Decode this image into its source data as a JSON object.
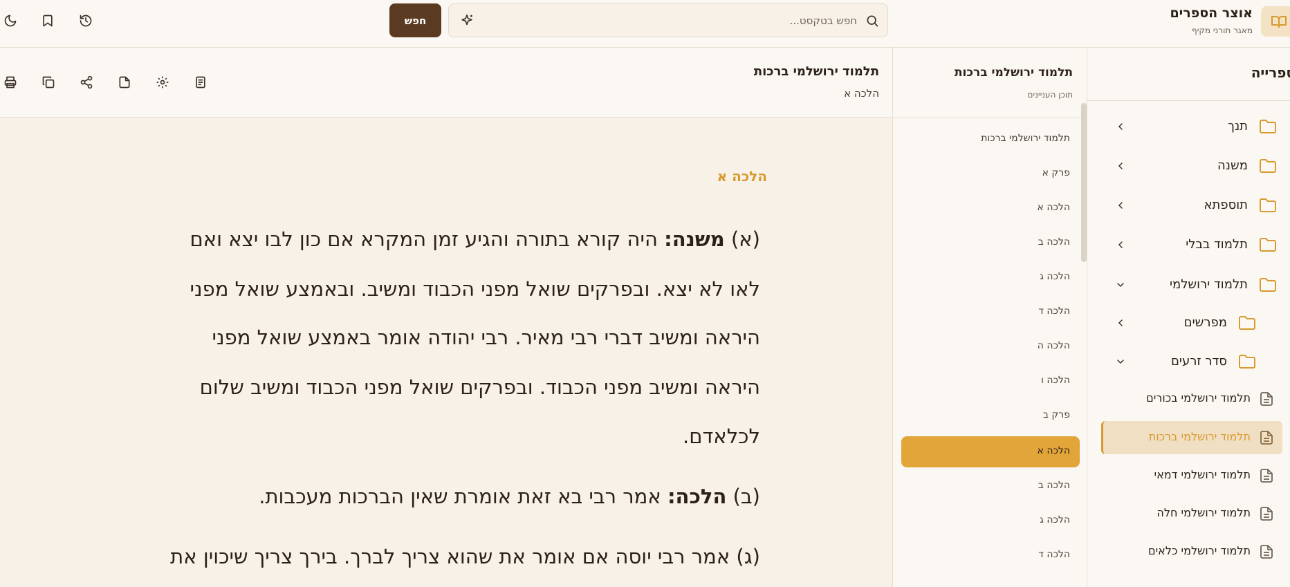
{
  "topbar": {
    "brand_title": "אוצר הספרים",
    "brand_subtitle": "מאגר תורני מקיף",
    "search_placeholder": "חפש בטקסט...",
    "search_button": "חפש"
  },
  "library": {
    "title": "ספרייה",
    "categories": [
      {
        "label": "תנך",
        "expanded": false
      },
      {
        "label": "משנה",
        "expanded": false
      },
      {
        "label": "תוספתא",
        "expanded": false
      },
      {
        "label": "תלמוד בבלי",
        "expanded": false
      },
      {
        "label": "תלמוד ירושלמי",
        "expanded": true
      }
    ],
    "subcategories": [
      {
        "label": "מפרשים",
        "expanded": false
      },
      {
        "label": "סדר זרעים",
        "expanded": true
      }
    ],
    "books": [
      {
        "label": "תלמוד ירושלמי בכורים",
        "selected": false
      },
      {
        "label": "תלמוד ירושלמי ברכות",
        "selected": true
      },
      {
        "label": "תלמוד ירושלמי דמאי",
        "selected": false
      },
      {
        "label": "תלמוד ירושלמי חלה",
        "selected": false
      },
      {
        "label": "תלמוד ירושלמי כלאים",
        "selected": false
      }
    ]
  },
  "toc": {
    "title": "תלמוד ירושלמי ברכות",
    "subtitle": "תוכן העניינים",
    "items": [
      {
        "label": "תלמוד ירושלמי ברכות",
        "active": false
      },
      {
        "label": "פרק א",
        "active": false
      },
      {
        "label": "הלכה א",
        "active": false
      },
      {
        "label": "הלכה ב",
        "active": false
      },
      {
        "label": "הלכה ג",
        "active": false
      },
      {
        "label": "הלכה ד",
        "active": false
      },
      {
        "label": "הלכה ה",
        "active": false
      },
      {
        "label": "הלכה ו",
        "active": false
      },
      {
        "label": "פרק ב",
        "active": false
      },
      {
        "label": "הלכה א",
        "active": true
      },
      {
        "label": "הלכה ב",
        "active": false
      },
      {
        "label": "הלכה ג",
        "active": false
      },
      {
        "label": "הלכה ד",
        "active": false
      }
    ]
  },
  "content": {
    "title": "תלמוד ירושלמי ברכות",
    "subtitle": "הלכה א",
    "section_heading": "הלכה א",
    "lines": [
      {
        "prefix": "(א) ",
        "bold": "משנה:",
        "text": " היה קורא בתורה והגיע זמן המקרא אם כון לבו יצא ואם"
      },
      {
        "prefix": "",
        "bold": "",
        "text": "לאו לא יצא. ובפרקים שואל מפני הכבוד ומשיב. ובאמצע שואל מפני"
      },
      {
        "prefix": "",
        "bold": "",
        "text": "היראה ומשיב דברי רבי מאיר. רבי יהודה אומר באמצע שואל מפני"
      },
      {
        "prefix": "",
        "bold": "",
        "text": "היראה ומשיב מפני הכבוד. ובפרקים שואל מפני הכבוד ומשיב שלום"
      },
      {
        "prefix": "",
        "bold": "",
        "text": "לכלאדם."
      },
      {
        "prefix": "(ב) ",
        "bold": "הלכה:",
        "text": " אמר רבי בא זאת אומרת שאין הברכות מעכבות."
      },
      {
        "prefix": "",
        "bold": "",
        "text": "(ג) אמר רבי יוסה אם אומר את שהוא צריך לברך. בירך צריך שיכוין את"
      }
    ]
  },
  "colors": {
    "accent": "#d89a2e",
    "search_button": "#5b3a22",
    "toc_active": "#e2a53a",
    "background": "#f7f1e8"
  }
}
